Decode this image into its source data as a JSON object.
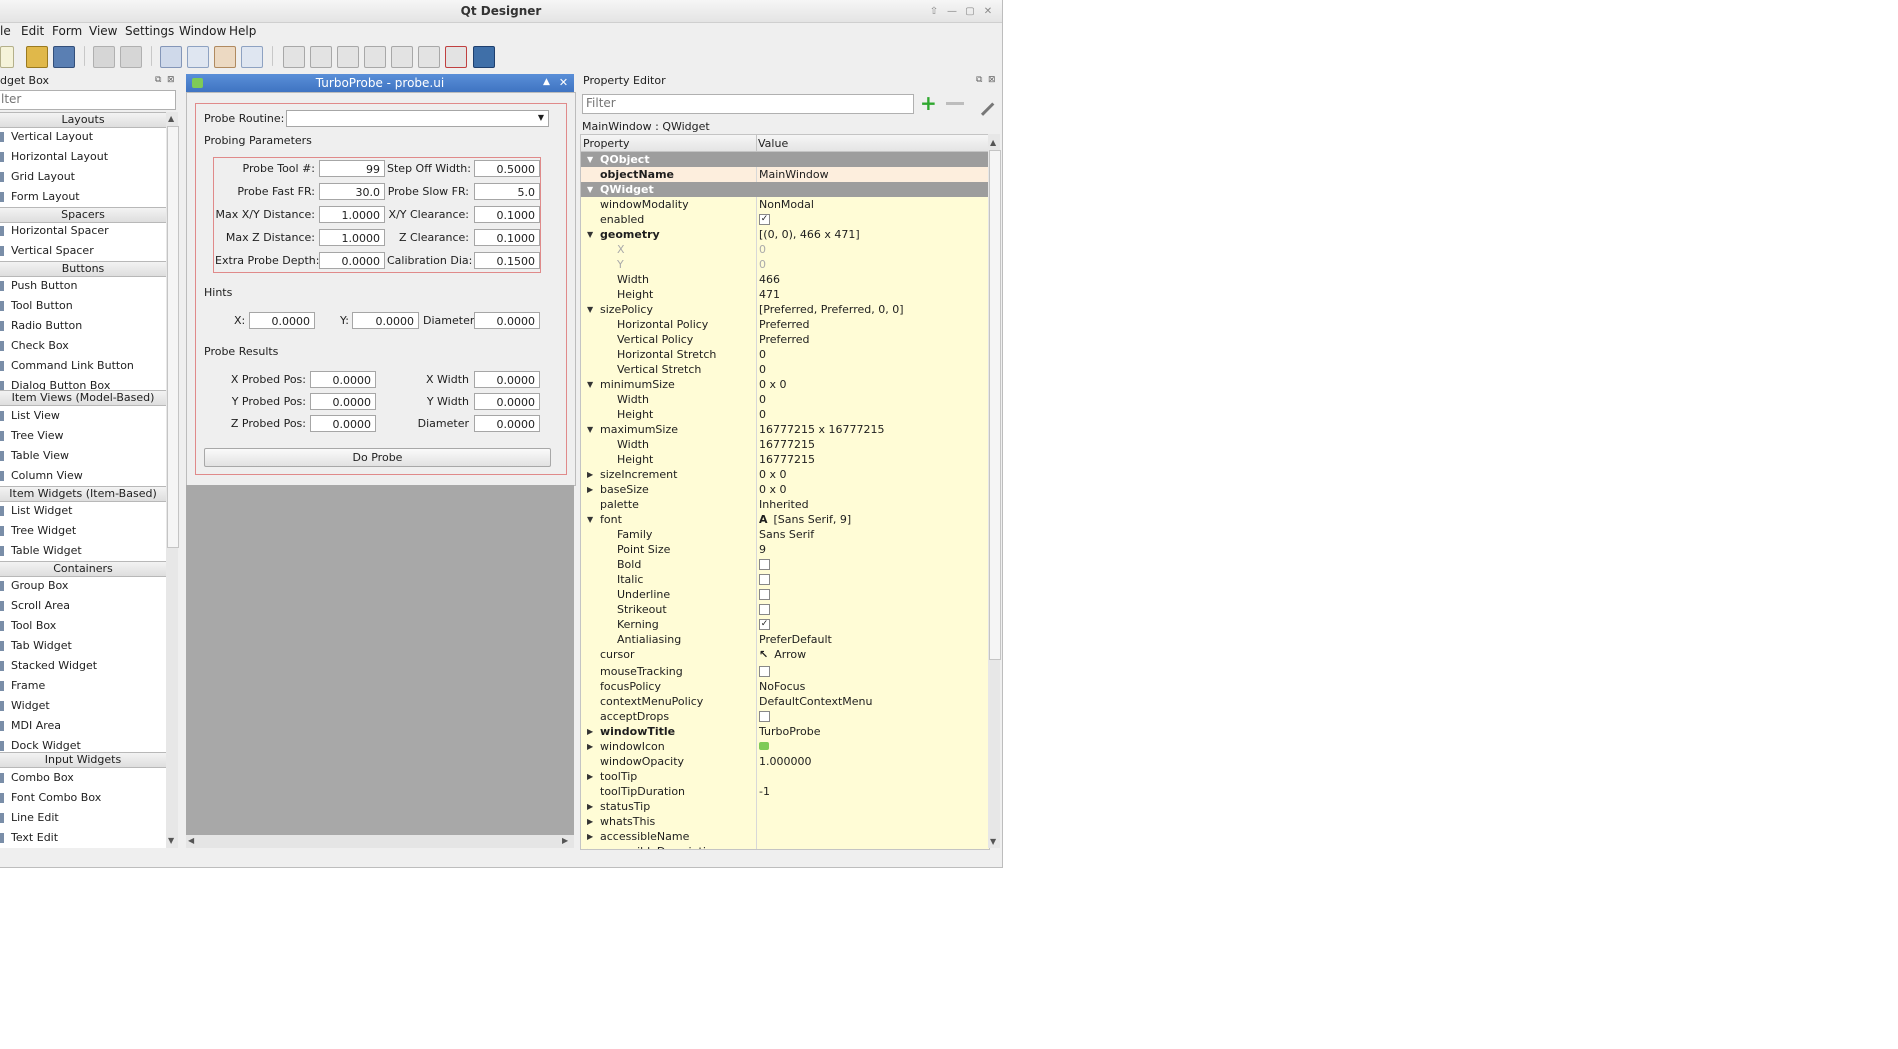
{
  "window": {
    "title": "Qt Designer"
  },
  "menubar": [
    "le",
    "Edit",
    "Form",
    "View",
    "Settings",
    "Window",
    "Help"
  ],
  "widget_box": {
    "title": "dget Box",
    "filter_placeholder": "lter",
    "items": [
      {
        "type": "cat",
        "label": "Layouts"
      },
      {
        "type": "item",
        "label": "Vertical Layout"
      },
      {
        "type": "item",
        "label": "Horizontal Layout"
      },
      {
        "type": "item",
        "label": "Grid Layout"
      },
      {
        "type": "item",
        "label": "Form Layout"
      },
      {
        "type": "cat",
        "label": "Spacers"
      },
      {
        "type": "item",
        "label": "Horizontal Spacer"
      },
      {
        "type": "item",
        "label": "Vertical Spacer"
      },
      {
        "type": "cat",
        "label": "Buttons"
      },
      {
        "type": "item",
        "label": "Push Button"
      },
      {
        "type": "item",
        "label": "Tool Button"
      },
      {
        "type": "item",
        "label": "Radio Button"
      },
      {
        "type": "item",
        "label": "Check Box"
      },
      {
        "type": "item",
        "label": "Command Link Button"
      },
      {
        "type": "item",
        "label": "Dialog Button Box"
      },
      {
        "type": "cat",
        "label": "Item Views (Model-Based)"
      },
      {
        "type": "item",
        "label": "List View"
      },
      {
        "type": "item",
        "label": "Tree View"
      },
      {
        "type": "item",
        "label": "Table View"
      },
      {
        "type": "item",
        "label": "Column View"
      },
      {
        "type": "cat",
        "label": "Item Widgets (Item-Based)"
      },
      {
        "type": "item",
        "label": "List Widget"
      },
      {
        "type": "item",
        "label": "Tree Widget"
      },
      {
        "type": "item",
        "label": "Table Widget"
      },
      {
        "type": "cat",
        "label": "Containers"
      },
      {
        "type": "item",
        "label": "Group Box"
      },
      {
        "type": "item",
        "label": "Scroll Area"
      },
      {
        "type": "item",
        "label": "Tool Box"
      },
      {
        "type": "item",
        "label": "Tab Widget"
      },
      {
        "type": "item",
        "label": "Stacked Widget"
      },
      {
        "type": "item",
        "label": "Frame"
      },
      {
        "type": "item",
        "label": "Widget"
      },
      {
        "type": "item",
        "label": "MDI Area"
      },
      {
        "type": "item",
        "label": "Dock Widget"
      },
      {
        "type": "cat",
        "label": "Input Widgets"
      },
      {
        "type": "item",
        "label": "Combo Box"
      },
      {
        "type": "item",
        "label": "Font Combo Box"
      },
      {
        "type": "item",
        "label": "Line Edit"
      },
      {
        "type": "item",
        "label": "Text Edit"
      }
    ]
  },
  "form": {
    "title": "TurboProbe - probe.ui",
    "probe_routine_label": "Probe Routine:",
    "probing_params_title": "Probing Parameters",
    "params": [
      {
        "l1": "Probe Tool #:",
        "v1": "99",
        "l2": "Step Off Width:",
        "v2": "0.5000"
      },
      {
        "l1": "Probe Fast FR:",
        "v1": "30.0",
        "l2": "Probe Slow FR:",
        "v2": "5.0"
      },
      {
        "l1": "Max X/Y Distance:",
        "v1": "1.0000",
        "l2": "X/Y Clearance:",
        "v2": "0.1000"
      },
      {
        "l1": "Max Z Distance:",
        "v1": "1.0000",
        "l2": "Z Clearance:",
        "v2": "0.1000"
      },
      {
        "l1": "Extra Probe Depth:",
        "v1": "0.0000",
        "l2": "Calibration Dia:",
        "v2": "0.1500"
      }
    ],
    "hints_title": "Hints",
    "hints": {
      "x_label": "X:",
      "x": "0.0000",
      "y_label": "Y:",
      "y": "0.0000",
      "d_label": "Diameter",
      "d": "0.0000"
    },
    "results_title": "Probe Results",
    "results": [
      {
        "l1": "X Probed Pos:",
        "v1": "0.0000",
        "l2": "X Width",
        "v2": "0.0000"
      },
      {
        "l1": "Y Probed Pos:",
        "v1": "0.0000",
        "l2": "Y Width",
        "v2": "0.0000"
      },
      {
        "l1": "Z Probed Pos:",
        "v1": "0.0000",
        "l2": "Diameter",
        "v2": "0.0000"
      }
    ],
    "do_probe": "Do Probe"
  },
  "property_editor": {
    "title": "Property Editor",
    "filter_placeholder": "Filter",
    "class_label": "MainWindow : QWidget",
    "col_property": "Property",
    "col_value": "Value",
    "rows": [
      {
        "k": "group",
        "n": "QObject",
        "a": "down"
      },
      {
        "k": "row",
        "n": "objectName",
        "v": "MainWindow",
        "bold": true,
        "bg": "#fdeedd"
      },
      {
        "k": "group",
        "n": "QWidget",
        "a": "down"
      },
      {
        "k": "row",
        "n": "windowModality",
        "v": "NonModal"
      },
      {
        "k": "row",
        "n": "enabled",
        "cb": true
      },
      {
        "k": "row",
        "n": "geometry",
        "v": "[(0, 0), 466 x 471]",
        "bold": true,
        "a": "down"
      },
      {
        "k": "row",
        "n": "X",
        "v": "0",
        "sub": true,
        "grey": true
      },
      {
        "k": "row",
        "n": "Y",
        "v": "0",
        "sub": true,
        "grey": true
      },
      {
        "k": "row",
        "n": "Width",
        "v": "466",
        "sub": true
      },
      {
        "k": "row",
        "n": "Height",
        "v": "471",
        "sub": true
      },
      {
        "k": "row",
        "n": "sizePolicy",
        "v": "[Preferred, Preferred, 0, 0]",
        "a": "down"
      },
      {
        "k": "row",
        "n": "Horizontal Policy",
        "v": "Preferred",
        "sub": true
      },
      {
        "k": "row",
        "n": "Vertical Policy",
        "v": "Preferred",
        "sub": true
      },
      {
        "k": "row",
        "n": "Horizontal Stretch",
        "v": "0",
        "sub": true
      },
      {
        "k": "row",
        "n": "Vertical Stretch",
        "v": "0",
        "sub": true
      },
      {
        "k": "row",
        "n": "minimumSize",
        "v": "0 x 0",
        "a": "down"
      },
      {
        "k": "row",
        "n": "Width",
        "v": "0",
        "sub": true
      },
      {
        "k": "row",
        "n": "Height",
        "v": "0",
        "sub": true
      },
      {
        "k": "row",
        "n": "maximumSize",
        "v": "16777215 x 16777215",
        "a": "down"
      },
      {
        "k": "row",
        "n": "Width",
        "v": "16777215",
        "sub": true
      },
      {
        "k": "row",
        "n": "Height",
        "v": "16777215",
        "sub": true
      },
      {
        "k": "row",
        "n": "sizeIncrement",
        "v": "0 x 0",
        "a": "right"
      },
      {
        "k": "row",
        "n": "baseSize",
        "v": "0 x 0",
        "a": "right"
      },
      {
        "k": "row",
        "n": "palette",
        "v": "Inherited"
      },
      {
        "k": "row",
        "n": "font",
        "v": "[Sans Serif, 9]",
        "a": "down",
        "icon": "A"
      },
      {
        "k": "row",
        "n": "Family",
        "v": "Sans Serif",
        "sub": true
      },
      {
        "k": "row",
        "n": "Point Size",
        "v": "9",
        "sub": true
      },
      {
        "k": "row",
        "n": "Bold",
        "cb": false,
        "sub": true
      },
      {
        "k": "row",
        "n": "Italic",
        "cb": false,
        "sub": true
      },
      {
        "k": "row",
        "n": "Underline",
        "cb": false,
        "sub": true
      },
      {
        "k": "row",
        "n": "Strikeout",
        "cb": false,
        "sub": true
      },
      {
        "k": "row",
        "n": "Kerning",
        "cb": true,
        "sub": true
      },
      {
        "k": "row",
        "n": "Antialiasing",
        "v": "PreferDefault",
        "sub": true
      },
      {
        "k": "row",
        "n": "cursor",
        "v": "Arrow",
        "icon": "↖",
        "tall": true
      },
      {
        "k": "row",
        "n": "mouseTracking",
        "cb": false
      },
      {
        "k": "row",
        "n": "focusPolicy",
        "v": "NoFocus"
      },
      {
        "k": "row",
        "n": "contextMenuPolicy",
        "v": "DefaultContextMenu"
      },
      {
        "k": "row",
        "n": "acceptDrops",
        "cb": false
      },
      {
        "k": "row",
        "n": "windowTitle",
        "v": "TurboProbe",
        "bold": true,
        "a": "right"
      },
      {
        "k": "row",
        "n": "windowIcon",
        "v": "",
        "iconbox": true,
        "a": "right"
      },
      {
        "k": "row",
        "n": "windowOpacity",
        "v": "1.000000"
      },
      {
        "k": "row",
        "n": "toolTip",
        "v": "",
        "a": "right"
      },
      {
        "k": "row",
        "n": "toolTipDuration",
        "v": "-1"
      },
      {
        "k": "row",
        "n": "statusTip",
        "v": "",
        "a": "right"
      },
      {
        "k": "row",
        "n": "whatsThis",
        "v": "",
        "a": "right"
      },
      {
        "k": "row",
        "n": "accessibleName",
        "v": "",
        "a": "right"
      },
      {
        "k": "row",
        "n": "accessibleDescription",
        "v": "",
        "a": "right"
      }
    ]
  }
}
